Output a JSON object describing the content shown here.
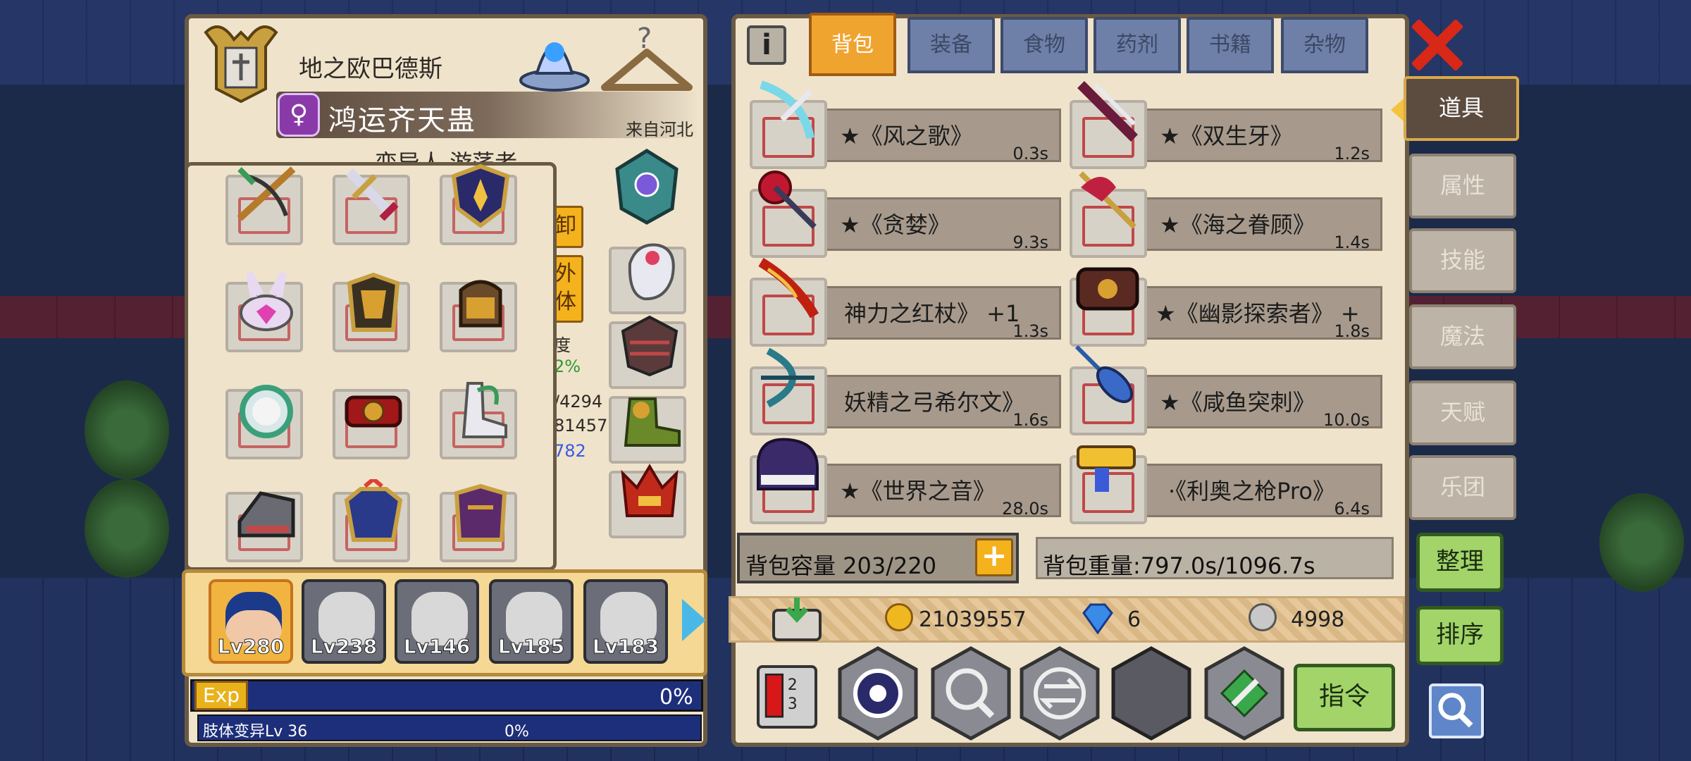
{
  "left_panel": {
    "title": "地之欧巴德斯",
    "character_name": "鸿运齐天蛊",
    "origin": "来自河北",
    "nickname": "变异人 游荡者",
    "gender_symbol": "♀",
    "side_button_1": "卸",
    "side_button_2": "外 体",
    "side_fragments": [
      "度",
      "2%",
      "/4294",
      "81457",
      "782"
    ]
  },
  "roster": {
    "characters": [
      {
        "level": "Lv280",
        "active": true
      },
      {
        "level": "Lv238",
        "active": false
      },
      {
        "level": "Lv146",
        "active": false
      },
      {
        "level": "Lv185",
        "active": false
      },
      {
        "level": "Lv183",
        "active": false
      }
    ]
  },
  "exp": {
    "label": "Exp",
    "percent": "0%",
    "mutation_label": "肢体变异Lv 36",
    "mutation_percent": "0%"
  },
  "tabs": {
    "info": "i",
    "items": [
      "背包",
      "装备",
      "食物",
      "药剂",
      "书籍",
      "杂物"
    ],
    "active": "背包"
  },
  "items": [
    {
      "name": "★《风之歌》",
      "time": "0.3s"
    },
    {
      "name": "★《双生牙》",
      "time": "1.2s"
    },
    {
      "name": "★《贪婪》",
      "time": "9.3s"
    },
    {
      "name": "★《海之眷顾》",
      "time": "1.4s"
    },
    {
      "name": "神力之红杖》 +1",
      "time": "1.3s"
    },
    {
      "name": "★《幽影探索者》 +",
      "time": "1.8s"
    },
    {
      "name": "妖精之弓希尔文》",
      "time": "1.6s"
    },
    {
      "name": "★《咸鱼突刺》",
      "time": "10.0s"
    },
    {
      "name": "★《世界之音》",
      "time": "28.0s"
    },
    {
      "name": "·《利奥之枪Pro》",
      "time": "6.4s"
    }
  ],
  "capacity": {
    "text": "背包容量 203/220",
    "plus": "+",
    "weight_text": "背包重量:797.0s/1096.7s"
  },
  "currency": {
    "gold": "21039557",
    "diamond": "6",
    "silver": "4998"
  },
  "actions": {
    "command": "指令"
  },
  "sidebar": {
    "tabs": [
      "道具",
      "属性",
      "技能",
      "魔法",
      "天赋",
      "乐团"
    ],
    "active": "道具",
    "sort_tidy": "整理",
    "sort_order": "排序"
  },
  "colors": {
    "tab_active": "#f0a430",
    "tab_inactive": "#6e80a8",
    "panel_bg": "#efe3cc",
    "green_button": "#a2d46a",
    "accent_gold": "#f4b21c"
  }
}
